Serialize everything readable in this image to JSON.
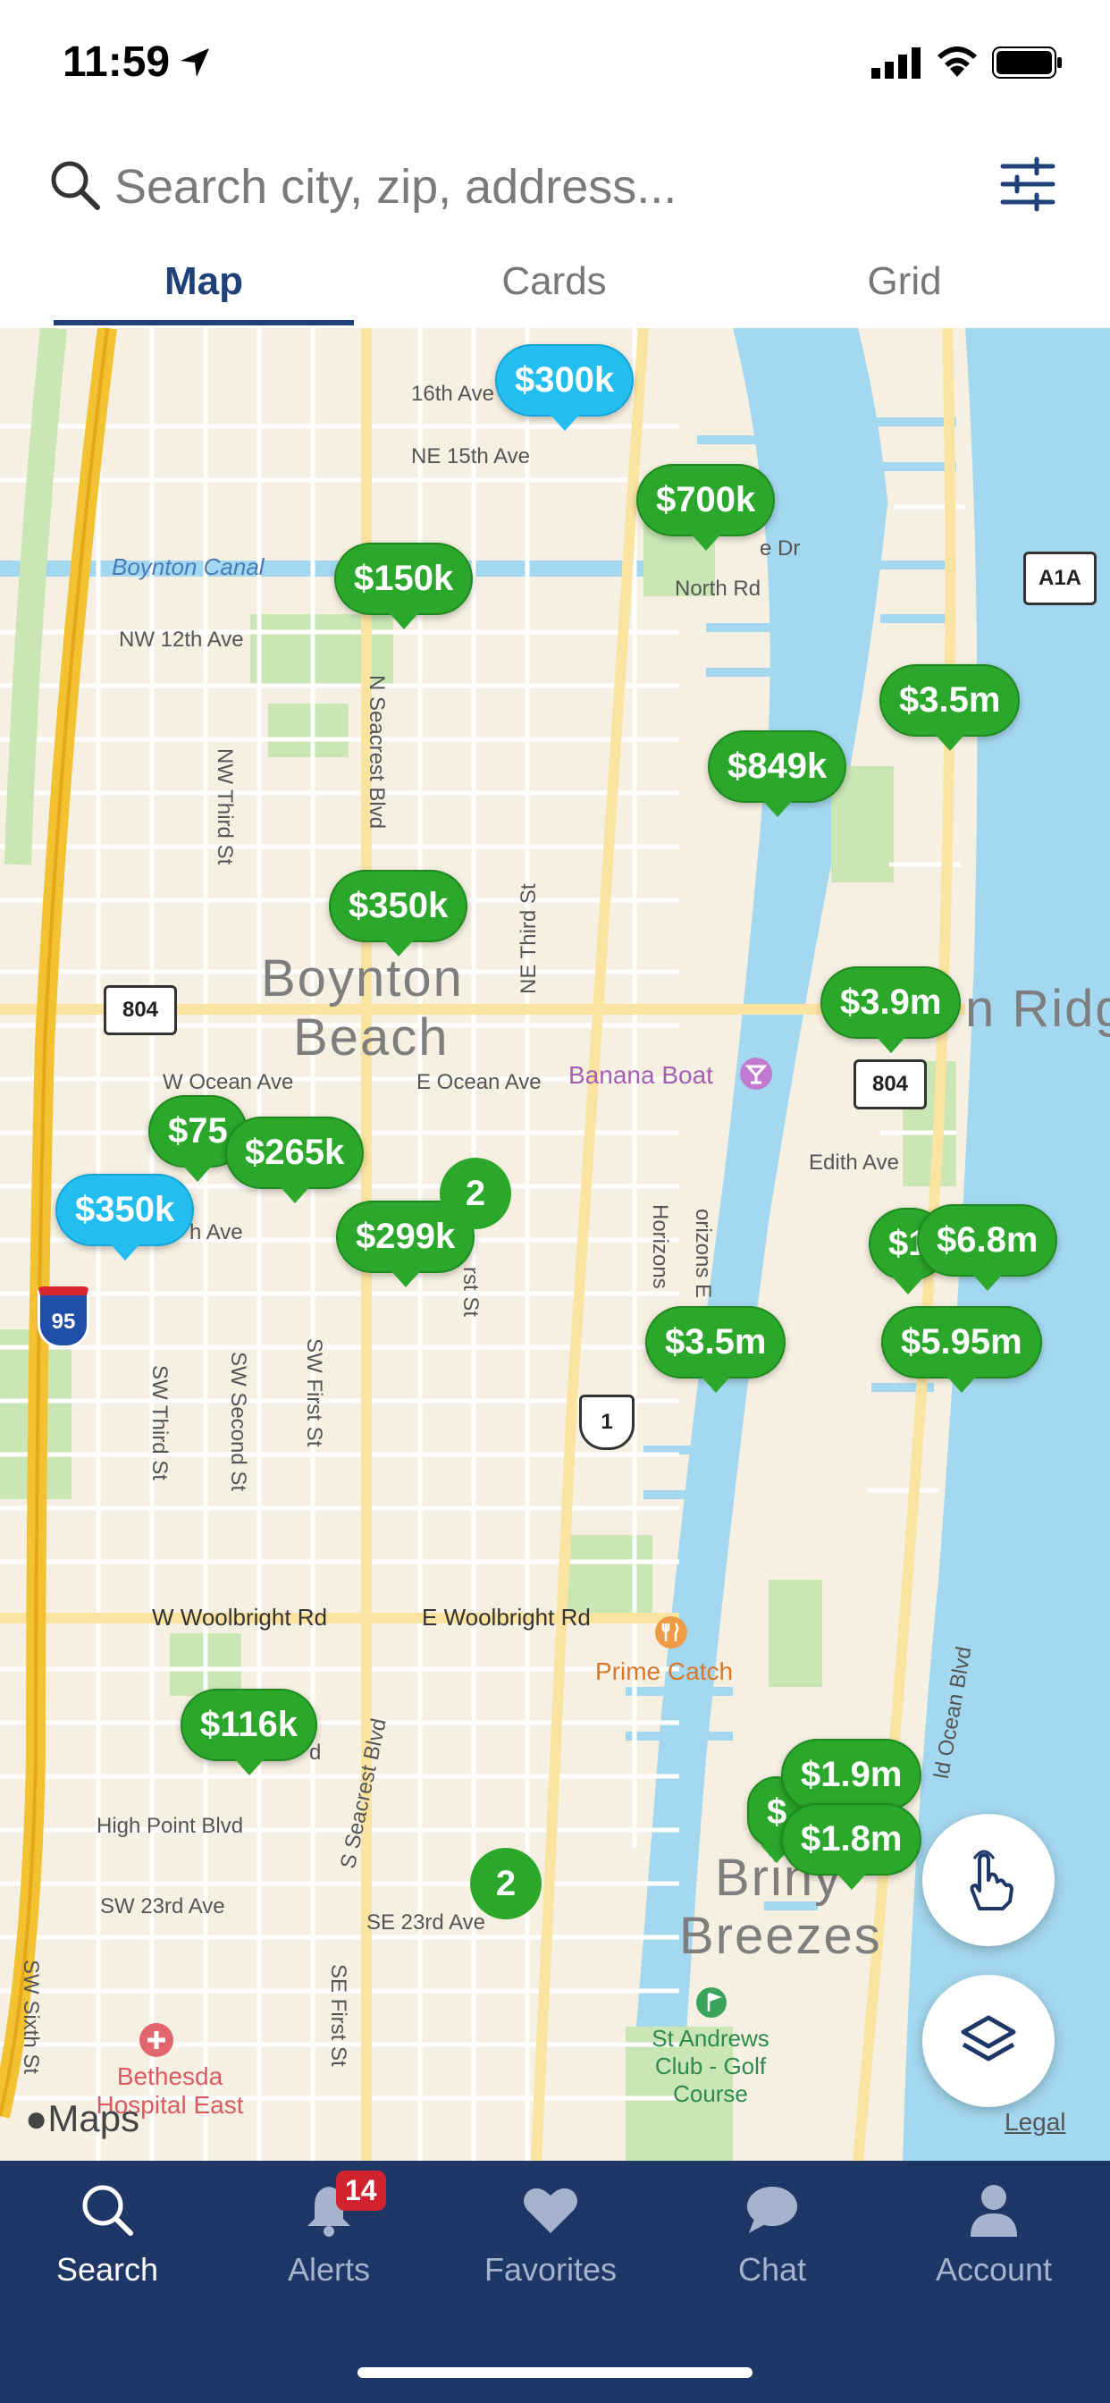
{
  "status": {
    "time": "11:59"
  },
  "search": {
    "placeholder": "Search city, zip, address..."
  },
  "tabs": [
    {
      "label": "Map",
      "active": true
    },
    {
      "label": "Cards",
      "active": false
    },
    {
      "label": "Grid",
      "active": false
    }
  ],
  "map": {
    "place_labels": {
      "boynton": "Boynton",
      "beach": "Beach",
      "briny": "Briny",
      "breezes": "Breezes",
      "ridge": "n Ridg"
    },
    "streets": {
      "ave16": "16th Ave",
      "ne15": "NE 15th Ave",
      "canal": "Boynton Canal",
      "nw12": "NW 12th Ave",
      "northrd": "North Rd",
      "edr": "e Dr",
      "seacrest_n": "N Seacrest Blvd",
      "nwthird": "NW Third St",
      "nethird": "NE Third St",
      "wocean": "W Ocean Ave",
      "eocean": "E Ocean Ave",
      "hhave": "h Ave",
      "edith": "Edith Ave",
      "horizons": "Horizons",
      "orizons": "orizons E",
      "swthird": "SW Third St",
      "swsecond": "SW Second St",
      "swfirst": "SW First St",
      "rstst": "rst St",
      "wwool": "W Woolbright Rd",
      "ewool": "E Woolbright Rd",
      "highpoint": "High Point Blvd",
      "sw23": "SW 23rd Ave",
      "se23": "SE 23rd Ave",
      "seacrest_s": "S Seacrest Blvd",
      "sefirst": "SE First St",
      "swsixth": "SW Sixth St",
      "oceanblvd": "ld Ocean Blvd",
      "bd": "d"
    },
    "pois": {
      "banana": "Banana Boat",
      "prime": "Prime Catch",
      "golf": "St Andrews Club - Golf Course",
      "hospital": "Bethesda Hospital East"
    },
    "shields": {
      "r804a": "804",
      "r804b": "804",
      "a1a": "A1A",
      "i95": "95",
      "us1": "1"
    },
    "pins": {
      "p300": "$300k",
      "p700": "$700k",
      "p150": "$150k",
      "p35a": "$3.5m",
      "p849": "$849k",
      "p350a": "$350k",
      "p39": "$3.9m",
      "p75": "$75",
      "p265": "$265k",
      "p350b": "$350k",
      "p299": "$299k",
      "p1": "$1",
      "p68": "$6.8m",
      "p35b": "$3.5m",
      "p595": "$5.95m",
      "p116": "$116k",
      "p19": "$1.9m",
      "p18": "$1.8m",
      "p_dollar": "$"
    },
    "clusters": {
      "c1": "2",
      "c2": "2"
    },
    "attribution": "Maps",
    "legal": "Legal"
  },
  "tabbar": {
    "items": [
      {
        "label": "Search",
        "icon": "search-icon"
      },
      {
        "label": "Alerts",
        "icon": "bell-icon"
      },
      {
        "label": "Favorites",
        "icon": "heart-icon"
      },
      {
        "label": "Chat",
        "icon": "chat-icon"
      },
      {
        "label": "Account",
        "icon": "person-icon"
      }
    ],
    "alerts_badge": "14"
  },
  "colors": {
    "brand": "#1e3766",
    "pin_green": "#2ba82b",
    "pin_blue": "#23bdf0",
    "water": "#a4d8f0"
  }
}
